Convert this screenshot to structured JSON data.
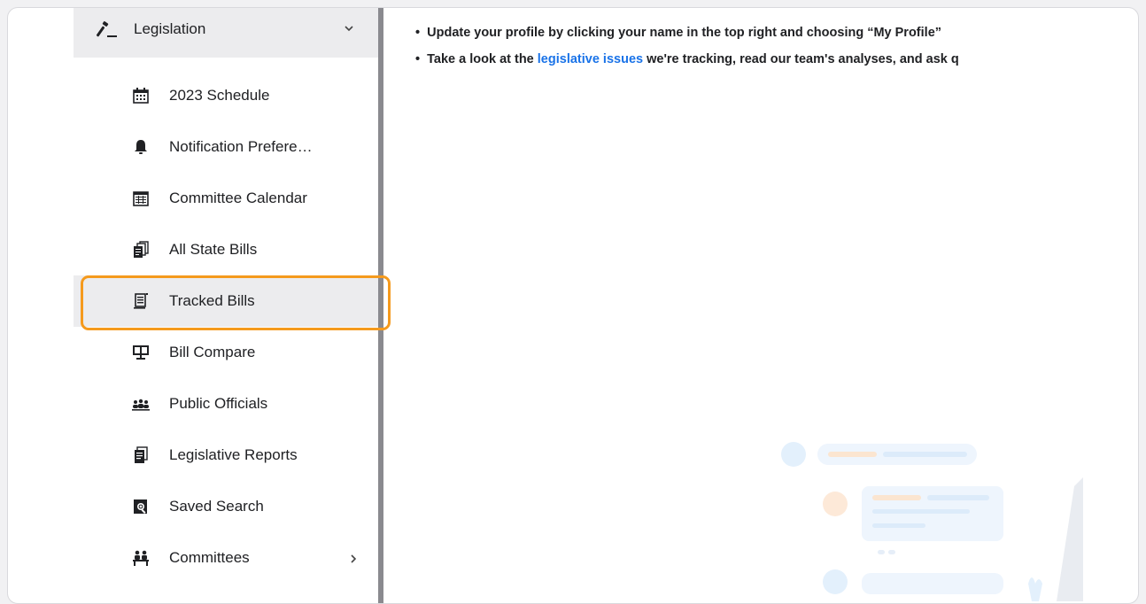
{
  "sidebar": {
    "section": {
      "label": "Legislation",
      "icon": "gavel-icon",
      "expanded": true
    },
    "items": [
      {
        "label": "2023 Schedule",
        "icon": "calendar-icon"
      },
      {
        "label": "Notification Prefere…",
        "icon": "bell-icon"
      },
      {
        "label": "Committee Calendar",
        "icon": "calendar-grid-icon"
      },
      {
        "label": "All State Bills",
        "icon": "stacked-documents-icon"
      },
      {
        "label": "Tracked Bills",
        "icon": "tracked-document-icon",
        "active": true
      },
      {
        "label": "Bill Compare",
        "icon": "compare-screens-icon"
      },
      {
        "label": "Public Officials",
        "icon": "people-group-icon"
      },
      {
        "label": "Legislative Reports",
        "icon": "report-document-icon"
      },
      {
        "label": "Saved Search",
        "icon": "document-search-icon"
      },
      {
        "label": "Committees",
        "icon": "committee-icon",
        "has_submenu": true
      }
    ]
  },
  "content": {
    "bullets": [
      {
        "text": "Update your profile by clicking your name in the top right and choosing “My Profile”"
      },
      {
        "before": "Take a look at the ",
        "link": "legislative issues",
        "after": " we're tracking, read our team's analyses, and ask q"
      }
    ]
  },
  "colors": {
    "highlight": "#f59a1d",
    "link": "#1a73e8",
    "active_bg": "#ececee",
    "divider": "#8a8a8f"
  }
}
